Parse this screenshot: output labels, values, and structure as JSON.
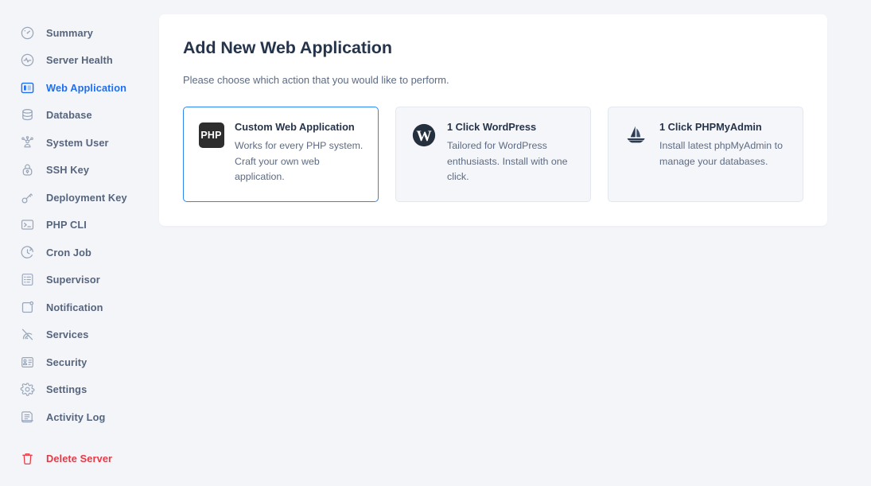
{
  "sidebar": {
    "items": [
      {
        "label": "Summary",
        "icon": "gauge-icon",
        "active": false,
        "danger": false
      },
      {
        "label": "Server Health",
        "icon": "pulse-icon",
        "active": false,
        "danger": false
      },
      {
        "label": "Web Application",
        "icon": "panel-layout-icon",
        "active": true,
        "danger": false
      },
      {
        "label": "Database",
        "icon": "database-icon",
        "active": false,
        "danger": false
      },
      {
        "label": "System User",
        "icon": "user-network-icon",
        "active": false,
        "danger": false
      },
      {
        "label": "SSH Key",
        "icon": "lock-icon",
        "active": false,
        "danger": false
      },
      {
        "label": "Deployment Key",
        "icon": "key-icon",
        "active": false,
        "danger": false
      },
      {
        "label": "PHP CLI",
        "icon": "terminal-icon",
        "active": false,
        "danger": false
      },
      {
        "label": "Cron Job",
        "icon": "clock-arrow-icon",
        "active": false,
        "danger": false
      },
      {
        "label": "Supervisor",
        "icon": "checklist-icon",
        "active": false,
        "danger": false
      },
      {
        "label": "Notification",
        "icon": "bell-corner-icon",
        "active": false,
        "danger": false
      },
      {
        "label": "Services",
        "icon": "services-icon",
        "active": false,
        "danger": false
      },
      {
        "label": "Security",
        "icon": "security-grid-icon",
        "active": false,
        "danger": false
      },
      {
        "label": "Settings",
        "icon": "gear-icon",
        "active": false,
        "danger": false
      },
      {
        "label": "Activity Log",
        "icon": "document-log-icon",
        "active": false,
        "danger": false
      }
    ],
    "footer_items": [
      {
        "label": "Delete Server",
        "icon": "trash-icon",
        "active": false,
        "danger": true
      }
    ],
    "active_color": "#1d6ff2",
    "danger_color": "#e63946",
    "label_color": "#56657e"
  },
  "main": {
    "title": "Add New Web Application",
    "subtitle": "Please choose which action that you would like to perform.",
    "cards": [
      {
        "title": "Custom Web Application",
        "description": "Works for every PHP system. Craft your own web application.",
        "icon": "php-icon",
        "icon_label": "PHP",
        "selected": true
      },
      {
        "title": "1 Click WordPress",
        "description": "Tailored for WordPress enthusiasts. Install with one click.",
        "icon": "wordpress-icon",
        "icon_label": "",
        "selected": false
      },
      {
        "title": "1 Click PHPMyAdmin",
        "description": "Install latest phpMyAdmin to manage your databases.",
        "icon": "phpmyadmin-sailboat-icon",
        "icon_label": "",
        "selected": false
      }
    ],
    "selected_border_color": "#2a86f5",
    "page_background": "#f4f5f9"
  }
}
